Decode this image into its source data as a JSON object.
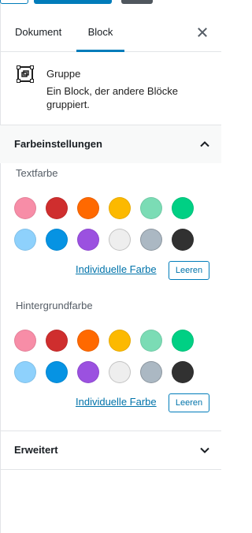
{
  "tabs": {
    "document": "Dokument",
    "block": "Block",
    "active": "Block"
  },
  "block": {
    "icon": "group-icon",
    "title": "Gruppe",
    "description": "Ein Block, der andere Blöcke gruppiert."
  },
  "color_panel": {
    "title": "Farbeinstellungen",
    "expanded": true,
    "text_color": {
      "label": "Textfarbe",
      "custom_label": "Individuelle Farbe",
      "clear_label": "Leeren"
    },
    "background_color": {
      "label": "Hintergrundfarbe",
      "custom_label": "Individuelle Farbe",
      "clear_label": "Leeren"
    },
    "palette": [
      "#f78da7",
      "#cf2e2e",
      "#ff6900",
      "#fcb900",
      "#7bdcb5",
      "#00d084",
      "#8ed1fc",
      "#0693e3",
      "#9b51e0",
      "#eeeeee",
      "#abb8c3",
      "#313131"
    ]
  },
  "advanced_panel": {
    "title": "Erweitert",
    "expanded": false
  },
  "colors": {
    "accent": "#007cba",
    "link": "#0073aa",
    "border": "#e2e4e7",
    "panel_bg": "#f8f9f9"
  }
}
